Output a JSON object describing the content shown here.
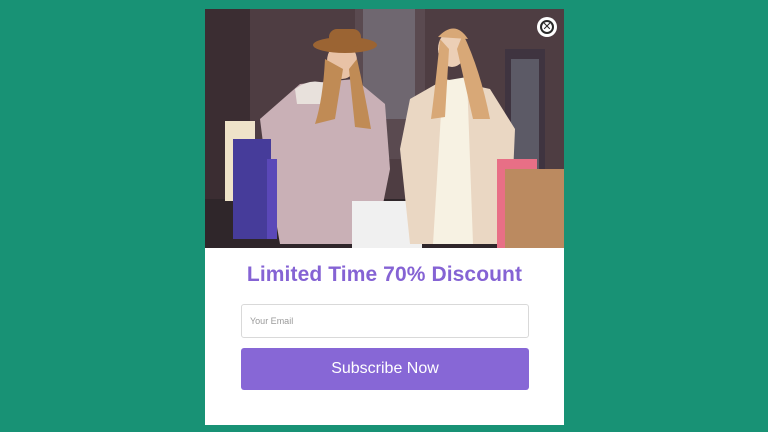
{
  "popup": {
    "hero_image": "shopping-women-photo",
    "close_icon": "close-icon",
    "title": "Limited Time 70% Discount",
    "email_placeholder": "Your Email",
    "email_value": "",
    "subscribe_label": "Subscribe Now"
  },
  "colors": {
    "background": "#189275",
    "accent": "#8767d6",
    "title": "#8563d4"
  }
}
